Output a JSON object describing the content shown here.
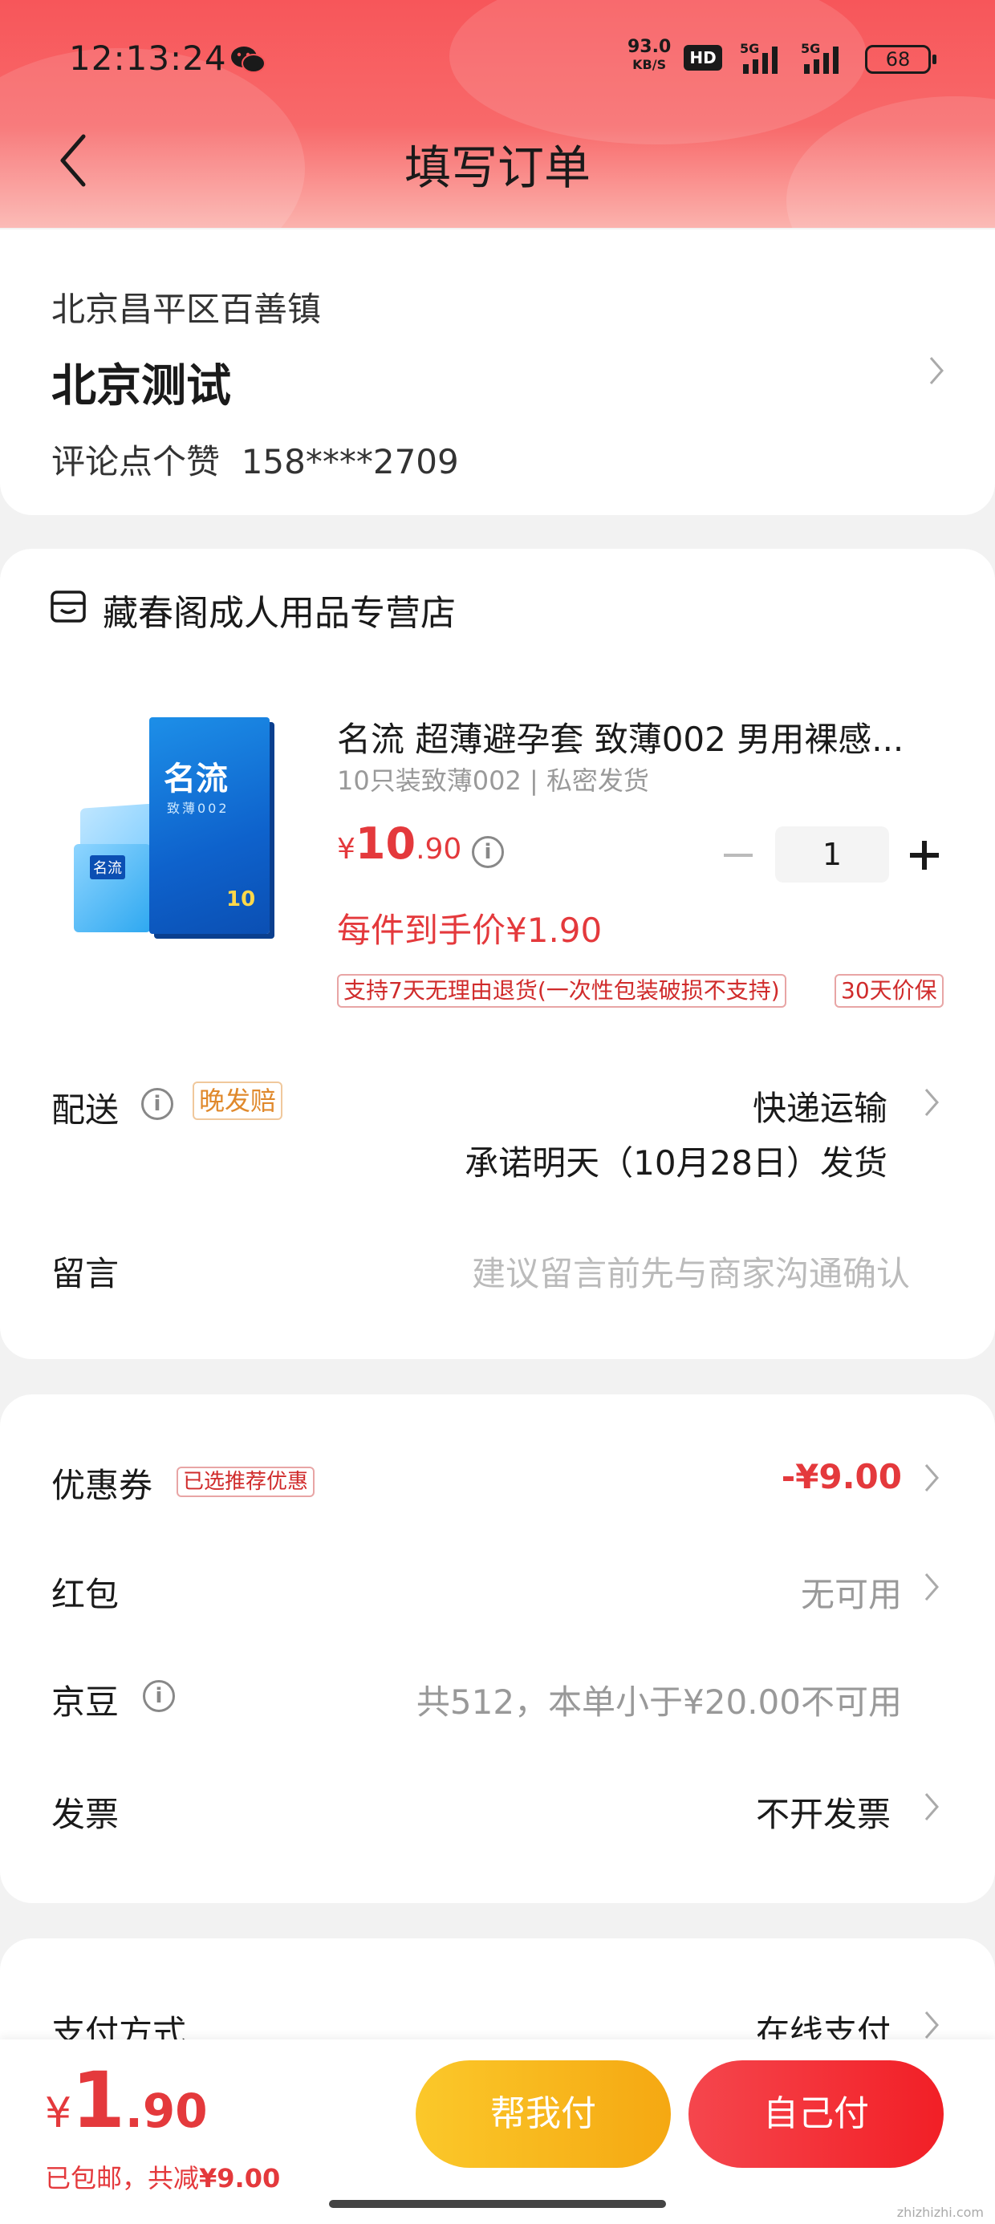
{
  "status_bar": {
    "time": "12:13:24",
    "net_speed": "93.0",
    "net_unit": "KB/S",
    "hd": "HD",
    "signal1": "5G",
    "signal2": "5G",
    "battery": "68"
  },
  "nav": {
    "title": "填写订单"
  },
  "address": {
    "region": "北京昌平区百善镇",
    "detail": "北京测试",
    "contact": "评论点个赞  158****2709"
  },
  "store": {
    "name": "藏春阁成人用品专营店"
  },
  "product": {
    "title": "名流 超薄避孕套 致薄002 男用裸感...",
    "spec": "10只装致薄002 | 私密发货",
    "price_symbol": "¥",
    "price_int": "10",
    "price_dec": ".90",
    "quantity": "1",
    "final_price": "每件到手价¥1.90",
    "tag_return": "支持7天无理由退货(一次性包装破损不支持)",
    "tag_price_protect": "30天价保",
    "box_brand": "名流",
    "box_sub": "致薄002",
    "box_count": "10"
  },
  "delivery": {
    "label": "配送",
    "badge": "晚发赔",
    "method": "快递运输",
    "promise": "承诺明天（10月28日）发货"
  },
  "message": {
    "label": "留言",
    "placeholder": "建议留言前先与商家沟通确认"
  },
  "benefits": {
    "coupon_label": "优惠券",
    "coupon_badge": "已选推荐优惠",
    "coupon_value": "-¥9.00",
    "redpacket_label": "红包",
    "redpacket_value": "无可用",
    "jingdou_label": "京豆",
    "jingdou_value": "共512，本单小于¥20.00不可用",
    "invoice_label": "发票",
    "invoice_value": "不开发票"
  },
  "payment": {
    "label": "支付方式",
    "value": "在线支付"
  },
  "footer": {
    "price_symbol": "¥",
    "price_int": "1",
    "price_dec": ".90",
    "shipping": "已包邮，共减",
    "saved": "¥9.00",
    "friend_pay": "帮我付",
    "self_pay": "自己付"
  },
  "watermark": "zhizhizhi.com",
  "colors": {
    "accent": "#e4393c",
    "header_top": "#f7565a",
    "friend_pay": "#f8b912",
    "self_pay": "#f23030"
  }
}
